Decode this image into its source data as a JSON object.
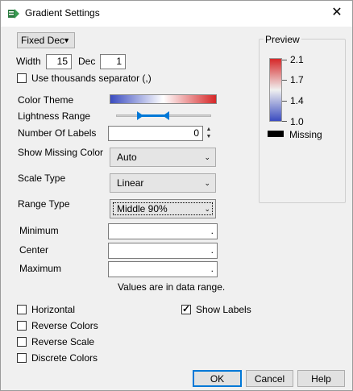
{
  "window": {
    "title": "Gradient Settings"
  },
  "format": {
    "selected": "Fixed Dec",
    "width_label": "Width",
    "width_value": "15",
    "dec_label": "Dec",
    "dec_value": "1",
    "thousands_label": "Use thousands separator (,)"
  },
  "labels": {
    "color_theme": "Color Theme",
    "lightness_range": "Lightness Range",
    "number_of_labels": "Number Of Labels",
    "show_missing_color": "Show Missing Color",
    "scale_type": "Scale Type",
    "range_type": "Range Type",
    "minimum": "Minimum",
    "center": "Center",
    "maximum": "Maximum",
    "values_note": "Values are in data range."
  },
  "values": {
    "number_of_labels": "0",
    "show_missing_color": "Auto",
    "scale_type": "Linear",
    "range_type": "Middle 90%",
    "minimum": ".",
    "center": ".",
    "maximum": "."
  },
  "colors": {
    "gradient_low": "#3b4cc0",
    "gradient_mid": "#dddddd",
    "gradient_high": "#d62728",
    "accent": "#0078d7"
  },
  "preview": {
    "title": "Preview",
    "ticks": [
      "2.1",
      "1.7",
      "1.4",
      "1.0"
    ],
    "missing_label": "Missing"
  },
  "options": {
    "horizontal": "Horizontal",
    "reverse_colors": "Reverse Colors",
    "reverse_scale": "Reverse Scale",
    "discrete_colors": "Discrete Colors",
    "show_labels": "Show Labels"
  },
  "buttons": {
    "ok": "OK",
    "cancel": "Cancel",
    "help": "Help"
  }
}
